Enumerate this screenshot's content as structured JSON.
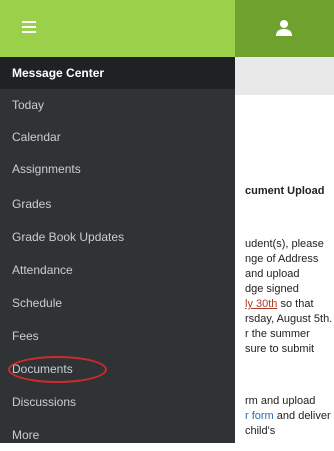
{
  "menu": [
    {
      "label": "Message Center",
      "active": true
    },
    {
      "label": "Today"
    },
    {
      "label": "Calendar"
    },
    {
      "label": "Assignments"
    },
    {
      "label": "Grades"
    },
    {
      "label": "Grade Book Updates"
    },
    {
      "label": "Attendance"
    },
    {
      "label": "Schedule"
    },
    {
      "label": "Fees"
    },
    {
      "label": "Documents"
    },
    {
      "label": "Discussions"
    },
    {
      "label": "More"
    }
  ],
  "content": {
    "heading": "cument Upload",
    "lines": [
      "udent(s), please",
      "nge of Address",
      "and upload",
      "dge signed",
      "ly 30th",
      " so that",
      "rsday, August 5th.",
      "r the summer",
      "sure to submit",
      "rm and upload",
      "r form",
      " and deliver",
      "child's"
    ]
  },
  "colors": {
    "topbar_left": "#9bd14a",
    "topbar_right": "#6fa12e",
    "drawer": "#2f3336",
    "highlight_circle": "#d02b2b"
  }
}
